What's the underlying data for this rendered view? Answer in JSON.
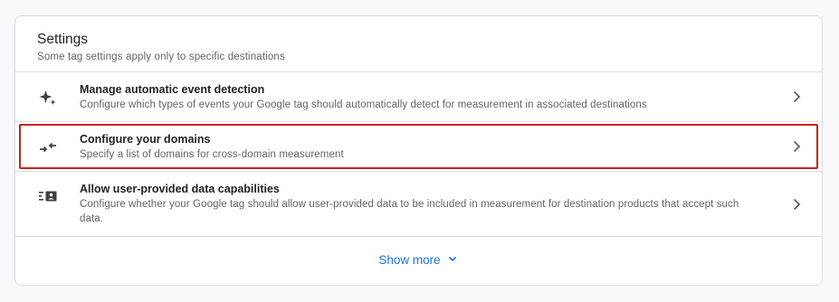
{
  "settings": {
    "title": "Settings",
    "subtitle": "Some tag settings apply only to specific destinations",
    "items": [
      {
        "title": "Manage automatic event detection",
        "description": "Configure which types of events your Google tag should automatically detect for measurement in associated destinations",
        "icon": "sparkle-icon"
      },
      {
        "title": "Configure your domains",
        "description": "Specify a list of domains for cross-domain measurement",
        "icon": "arrows-inward-icon",
        "highlighted": true
      },
      {
        "title": "Allow user-provided data capabilities",
        "description": "Configure whether your Google tag should allow user-provided data to be included in measurement for destination products that accept such data.",
        "icon": "user-data-icon"
      }
    ],
    "show_more_label": "Show more"
  },
  "colors": {
    "accent": "#1a73e8",
    "highlight_border": "#c5221f",
    "divider": "#dadce0"
  }
}
